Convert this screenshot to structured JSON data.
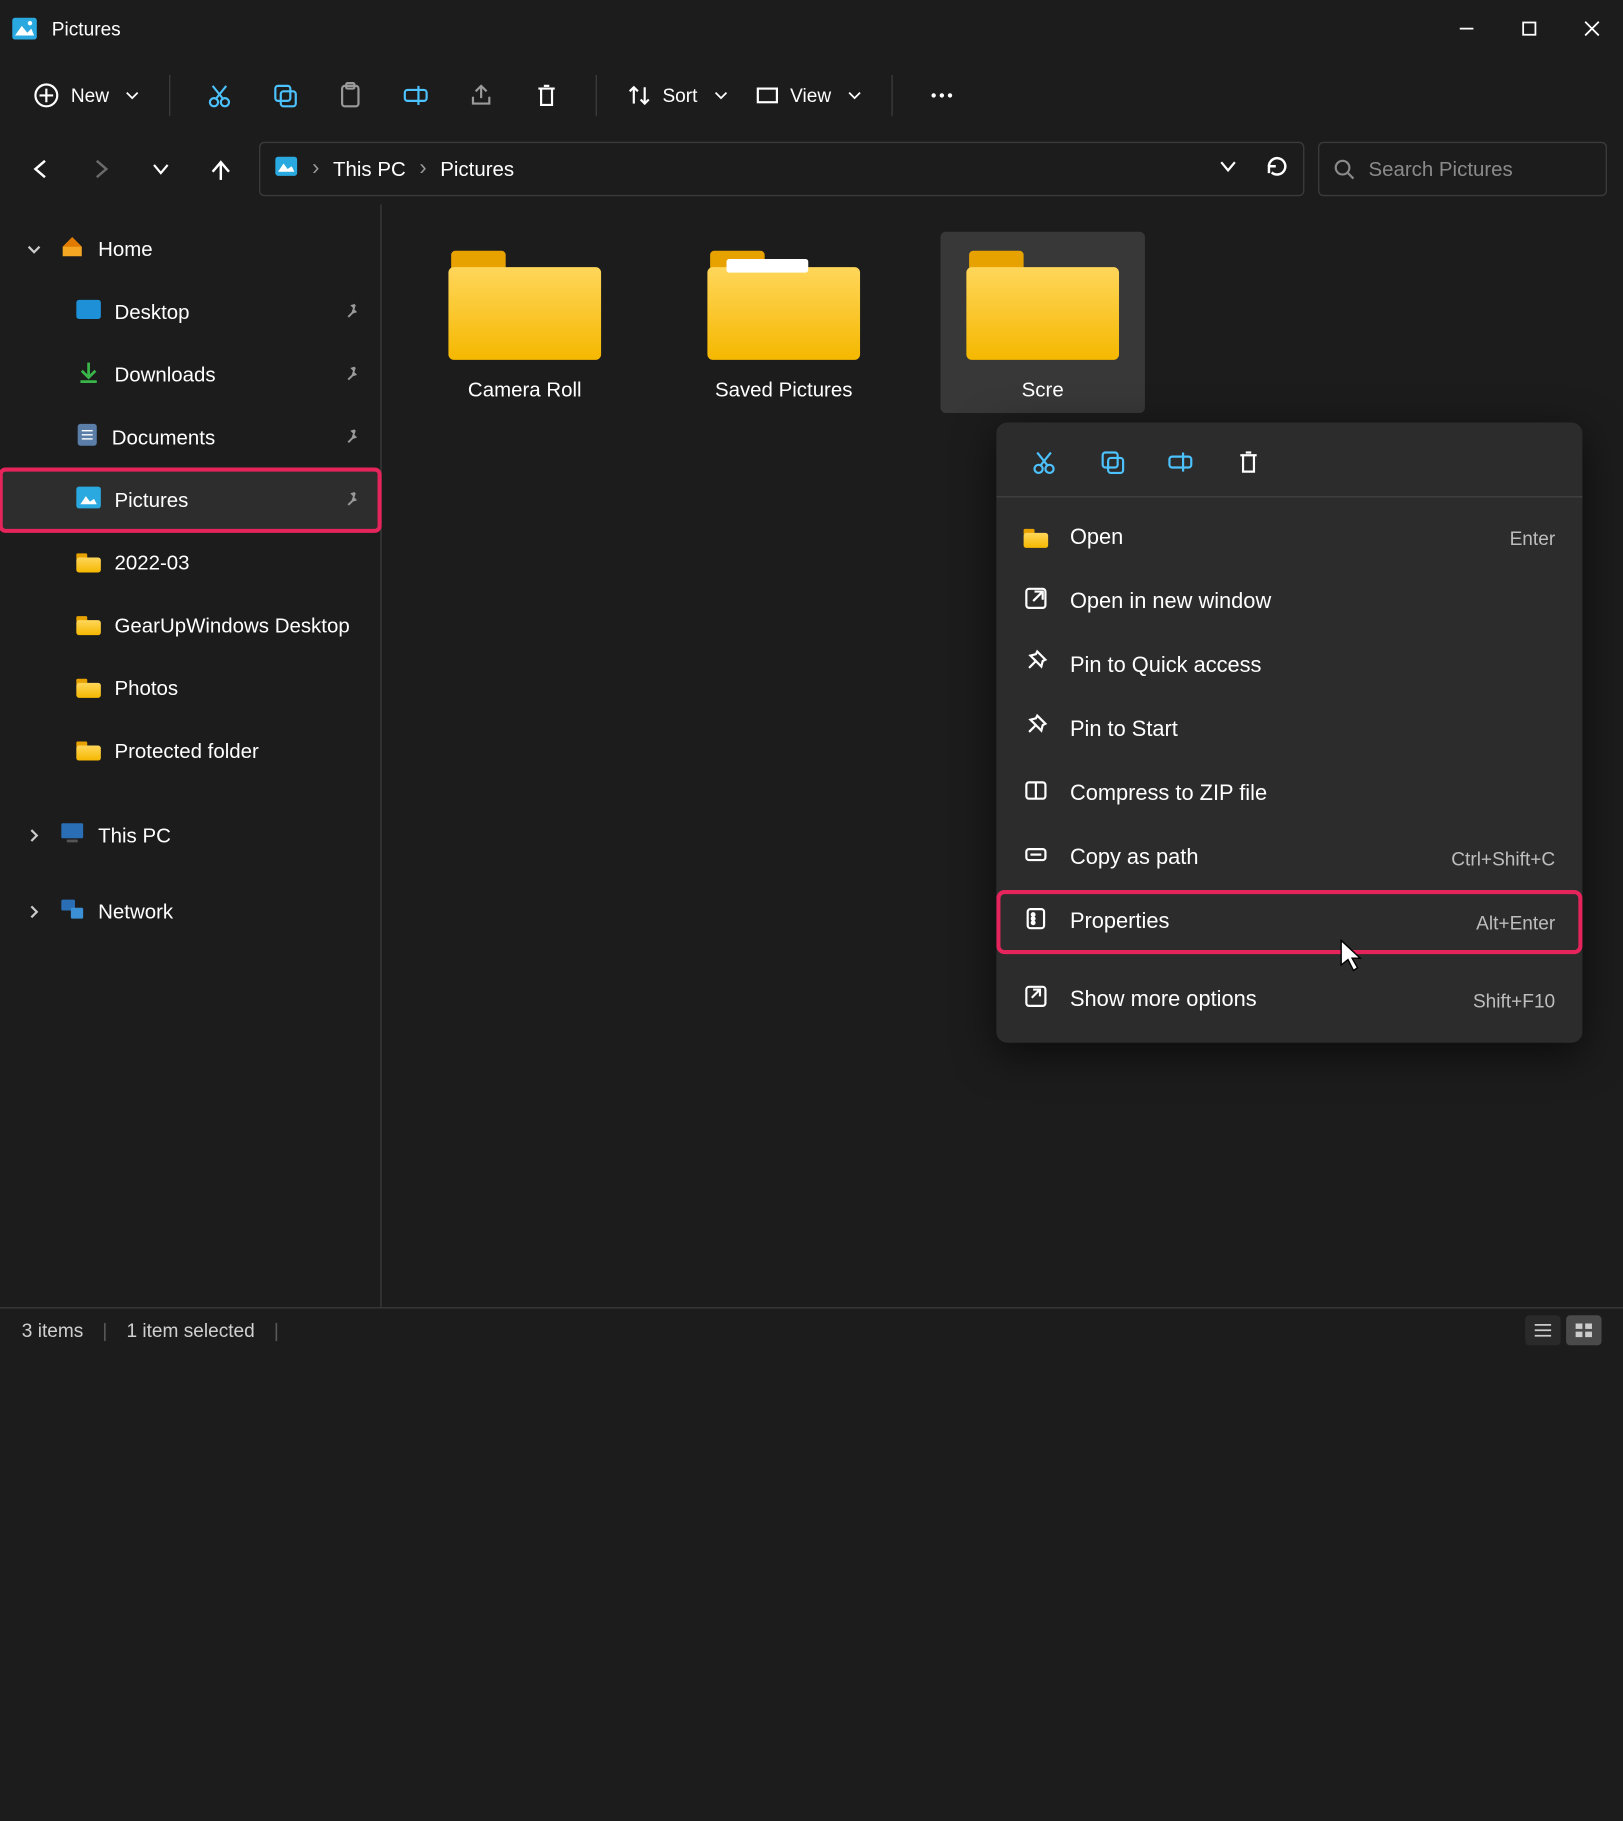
{
  "titlebar": {
    "title": "Pictures"
  },
  "toolbar": {
    "new_label": "New",
    "sort_label": "Sort",
    "view_label": "View"
  },
  "breadcrumb": {
    "items": [
      "This PC",
      "Pictures"
    ]
  },
  "search": {
    "placeholder": "Search Pictures"
  },
  "sidebar": {
    "home": "Home",
    "items": [
      {
        "label": "Desktop",
        "pinned": true
      },
      {
        "label": "Downloads",
        "pinned": true
      },
      {
        "label": "Documents",
        "pinned": true
      },
      {
        "label": "Pictures",
        "pinned": true,
        "selected": true
      },
      {
        "label": "2022-03"
      },
      {
        "label": "GearUpWindows Desktop"
      },
      {
        "label": "Photos"
      },
      {
        "label": "Protected folder"
      }
    ],
    "thispc": "This PC",
    "network": "Network"
  },
  "folders": [
    {
      "label": "Camera Roll"
    },
    {
      "label": "Saved Pictures"
    },
    {
      "label": "Screenshots",
      "selected": true,
      "display": "Scre"
    }
  ],
  "contextmenu": {
    "items": [
      {
        "label": "Open",
        "shortcut": "Enter",
        "icon": "folder"
      },
      {
        "label": "Open in new window",
        "icon": "open-new"
      },
      {
        "label": "Pin to Quick access",
        "icon": "pin"
      },
      {
        "label": "Pin to Start",
        "icon": "pin"
      },
      {
        "label": "Compress to ZIP file",
        "icon": "zip"
      },
      {
        "label": "Copy as path",
        "shortcut": "Ctrl+Shift+C",
        "icon": "path"
      },
      {
        "label": "Properties",
        "shortcut": "Alt+Enter",
        "icon": "properties",
        "highlight": true
      },
      {
        "label": "Show more options",
        "shortcut": "Shift+F10",
        "icon": "more",
        "gap_before": true
      }
    ]
  },
  "statusbar": {
    "count": "3 items",
    "selected": "1 item selected"
  }
}
